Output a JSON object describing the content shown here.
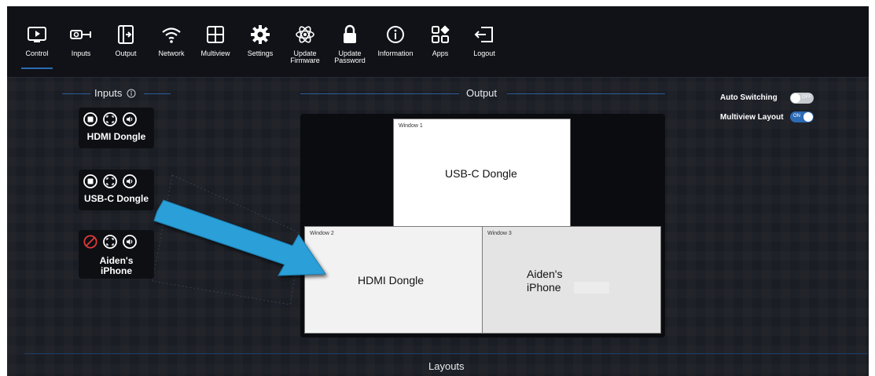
{
  "nav": [
    {
      "label": "Control",
      "icon": "play-screen-icon"
    },
    {
      "label": "Inputs",
      "icon": "input-plug-icon"
    },
    {
      "label": "Output",
      "icon": "output-box-icon"
    },
    {
      "label": "Network",
      "icon": "wifi-icon"
    },
    {
      "label": "Multiview",
      "icon": "grid-icon"
    },
    {
      "label": "Settings",
      "icon": "gear-icon"
    },
    {
      "label": "Update\nFirmware",
      "icon": "atom-icon"
    },
    {
      "label": "Update\nPassword",
      "icon": "lock-icon"
    },
    {
      "label": "Information",
      "icon": "info-icon"
    },
    {
      "label": "Apps",
      "icon": "apps-icon"
    },
    {
      "label": "Logout",
      "icon": "logout-icon"
    }
  ],
  "inputs": {
    "title": "Inputs",
    "items": [
      {
        "name": "HDMI Dongle",
        "blocked": false
      },
      {
        "name": "USB-C Dongle",
        "blocked": false
      },
      {
        "name": "Aiden's\niPhone",
        "blocked": true
      }
    ]
  },
  "output": {
    "title": "Output",
    "windows": [
      {
        "label": "Window 1",
        "source": "USB-C Dongle"
      },
      {
        "label": "Window 2",
        "source": "HDMI Dongle"
      },
      {
        "label": "Window 3",
        "source": "Aiden's\niPhone"
      }
    ]
  },
  "settings": {
    "auto_switching_label": "Auto Switching",
    "auto_switching_state": "OFF",
    "multiview_layout_label": "Multiview Layout",
    "multiview_layout_state": "ON"
  },
  "layouts_title": "Layouts",
  "colors": {
    "accent": "#2d6bb5",
    "arrow": "#2a9fd8",
    "block": "#e03a3a"
  }
}
